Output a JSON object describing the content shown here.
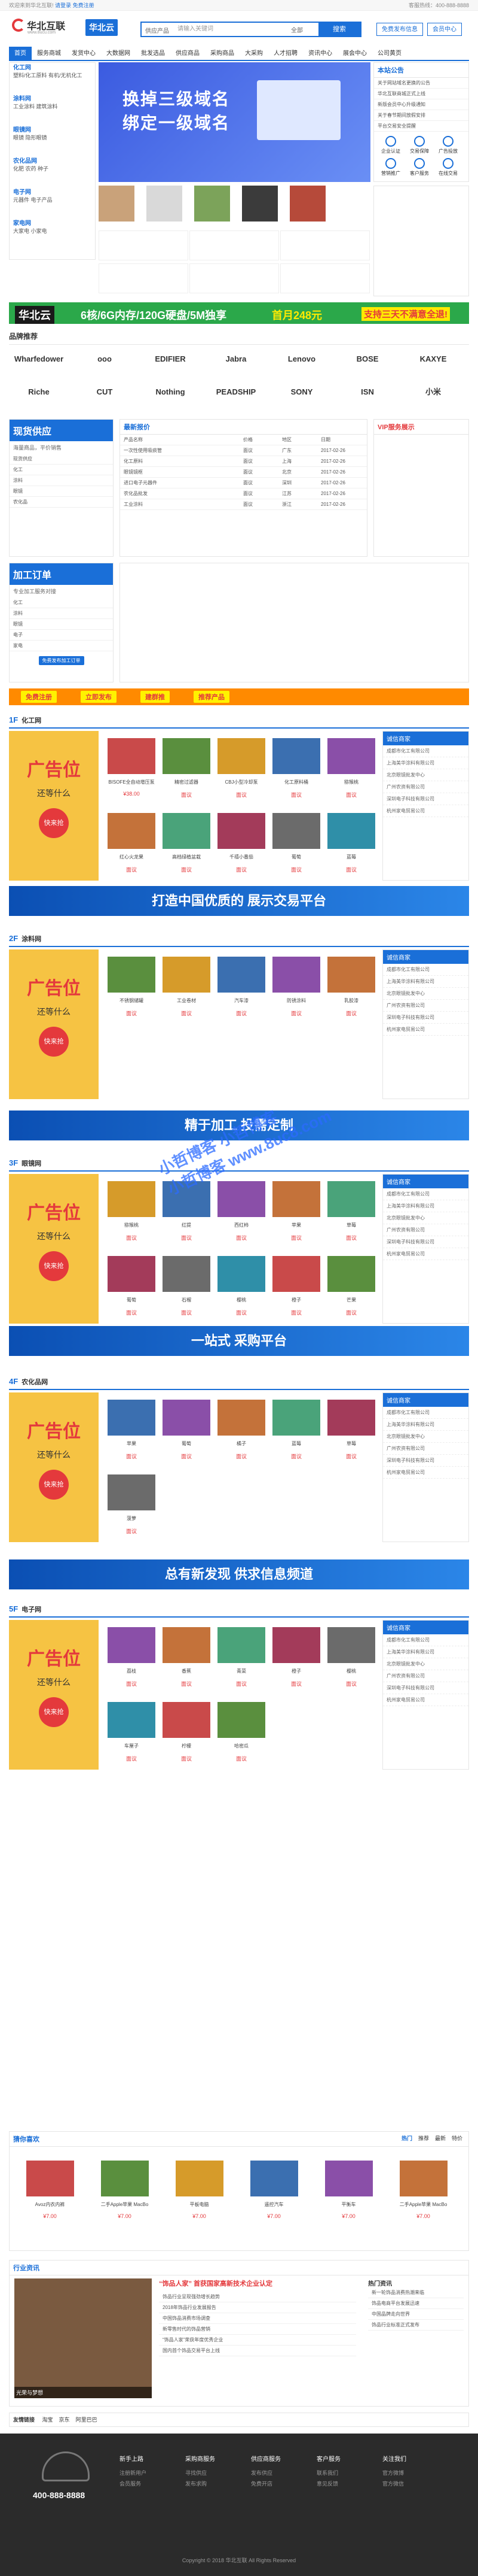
{
  "top": {
    "left": "欢迎来到华北互联!",
    "login": "请登录",
    "register": "免费注册",
    "right": "客服热线：400-888-8888"
  },
  "header": {
    "logo": "华北互联",
    "logo_sub": "www.8ucu.com",
    "logo2": "华北云",
    "search_kind": "供应产品",
    "search_placeholder": "请输入关键词",
    "search_select": "全部",
    "search_button": "搜索",
    "btn1": "免费发布信息",
    "btn2": "会员中心"
  },
  "nav": [
    "首页",
    "服务商城",
    "发货中心",
    "大数据网",
    "批发选品",
    "供应商品",
    "采购商品",
    "大采购",
    "人才招聘",
    "资讯中心",
    "展会中心",
    "公司黄页"
  ],
  "categories": [
    {
      "title": "化工网",
      "items": "塑料/化工原料 有机/无机化工"
    },
    {
      "title": "涂料网",
      "items": "工业涂料 建筑涂料"
    },
    {
      "title": "眼镜网",
      "items": "眼镜 隐形眼镜"
    },
    {
      "title": "农化品网",
      "items": "化肥 农药 种子"
    },
    {
      "title": "电子网",
      "items": "元器件 电子产品"
    },
    {
      "title": "家电网",
      "items": "大家电 小家电"
    }
  ],
  "banner": {
    "line1": "换掉三级域名",
    "line2": "绑定一级域名"
  },
  "news_right": {
    "title": "本站公告",
    "items": [
      "关于网站域名更换的公告",
      "华北互联商城正式上线",
      "新版会员中心升级通知",
      "关于春节期间放假安排",
      "平台交易安全提醒"
    ]
  },
  "service_icons": [
    "企业认证",
    "交易保障",
    "广告投放",
    "营销推广",
    "客户服务",
    "在线交易"
  ],
  "promo_bar": {
    "brand": "华北云",
    "text": "6核/6G内存/120G硬盘/5M独享",
    "price": "首月248元",
    "right": "支持三天不满意全退!"
  },
  "brands_title": "品牌推荐",
  "brands": [
    "Wharfedower",
    "ooo",
    "EDIFIER",
    "Jabra",
    "Lenovo",
    "BOSE",
    "KAXYE",
    "Riche",
    "CUT",
    "Nothing",
    "PEADSHIP",
    "SONY",
    "ISN",
    "小米"
  ],
  "supply": {
    "title": "现货供应",
    "subtitle": "海量商品，平价销售",
    "left_list": [
      "现货供应",
      "化工",
      "涂料",
      "眼镜",
      "农化品"
    ],
    "tab_title": "最新报价",
    "cols": [
      "产品名称",
      "价格",
      "地区",
      "日期"
    ],
    "rows": [
      [
        "一次性使用吸痰管",
        "面议",
        "广东",
        "2017-02-26"
      ],
      [
        "化工原料",
        "面议",
        "上海",
        "2017-02-26"
      ],
      [
        "眼镜镜框",
        "面议",
        "北京",
        "2017-02-26"
      ],
      [
        "进口电子元器件",
        "面议",
        "深圳",
        "2017-02-26"
      ],
      [
        "农化品批发",
        "面议",
        "江苏",
        "2017-02-26"
      ],
      [
        "工业涂料",
        "面议",
        "浙江",
        "2017-02-26"
      ]
    ],
    "vip_title": "VIP服务展示"
  },
  "process": {
    "title": "加工订单",
    "subtitle": "专业加工服务对接",
    "list": [
      "化工",
      "涂料",
      "眼镜",
      "电子",
      "家电"
    ],
    "btn": "免费发布加工订单"
  },
  "orange_bar": [
    "免费注册",
    "立即发布",
    "建群推",
    "推荐产品"
  ],
  "floors": [
    {
      "no": "1F",
      "name": "化工网",
      "products": [
        {
          "n": "BISOFE全自动增压泵",
          "p": "¥38.00"
        },
        {
          "n": "精密过滤器",
          "p": "面议"
        },
        {
          "n": "CBJ小型冷却泵",
          "p": "面议"
        },
        {
          "n": "化工原料桶",
          "p": "面议"
        },
        {
          "n": "猕猴桃",
          "p": "面议"
        },
        {
          "n": "红心火龙果",
          "p": "面议"
        },
        {
          "n": "高档绿植盆栽",
          "p": "面议"
        },
        {
          "n": "千禧小番茄",
          "p": "面议"
        },
        {
          "n": "葡萄",
          "p": "面议"
        },
        {
          "n": "蓝莓",
          "p": "面议"
        }
      ]
    },
    {
      "no": "2F",
      "name": "涂料网",
      "products": [
        {
          "n": "不锈钢储罐",
          "p": "面议"
        },
        {
          "n": "工业卷材",
          "p": "面议"
        },
        {
          "n": "汽车漆",
          "p": "面议"
        },
        {
          "n": "防锈涂料",
          "p": "面议"
        },
        {
          "n": "乳胶漆",
          "p": "面议"
        }
      ]
    },
    {
      "no": "3F",
      "name": "眼镜网",
      "products": [
        {
          "n": "猕猴桃",
          "p": "面议"
        },
        {
          "n": "红提",
          "p": "面议"
        },
        {
          "n": "西红柿",
          "p": "面议"
        },
        {
          "n": "苹果",
          "p": "面议"
        },
        {
          "n": "草莓",
          "p": "面议"
        },
        {
          "n": "葡萄",
          "p": "面议"
        },
        {
          "n": "石榴",
          "p": "面议"
        },
        {
          "n": "樱桃",
          "p": "面议"
        },
        {
          "n": "橙子",
          "p": "面议"
        },
        {
          "n": "芒果",
          "p": "面议"
        }
      ]
    },
    {
      "no": "4F",
      "name": "农化品网",
      "products": [
        {
          "n": "苹果",
          "p": "面议"
        },
        {
          "n": "葡萄",
          "p": "面议"
        },
        {
          "n": "橘子",
          "p": "面议"
        },
        {
          "n": "蓝莓",
          "p": "面议"
        },
        {
          "n": "草莓",
          "p": "面议"
        },
        {
          "n": "菠萝",
          "p": "面议"
        }
      ]
    },
    {
      "no": "5F",
      "name": "电子网",
      "products": [
        {
          "n": "荔枝",
          "p": "面议"
        },
        {
          "n": "香蕉",
          "p": "面议"
        },
        {
          "n": "青菜",
          "p": "面议"
        },
        {
          "n": "橙子",
          "p": "面议"
        },
        {
          "n": "樱桃",
          "p": "面议"
        },
        {
          "n": "车厘子",
          "p": "面议"
        },
        {
          "n": "柠檬",
          "p": "面议"
        },
        {
          "n": "哈密瓜",
          "p": "面议"
        }
      ]
    }
  ],
  "ad_text": {
    "a1": "广告位",
    "a2": "还等什么",
    "a3": "快来抢"
  },
  "floor_side_title": "诚信商家",
  "floor_side_items": [
    "成都市化工有限公司",
    "上海美华涂料有限公司",
    "北京眼镜批发中心",
    "广州农资有限公司",
    "深圳电子科技有限公司",
    "杭州家电贸易公司"
  ],
  "strips": [
    "打造中国优质的 展示交易平台",
    "精于加工 投需定制",
    "一站式 采购平台",
    "总有新发现 供求信息频道"
  ],
  "hot": {
    "title": "猜你喜欢",
    "tabs": [
      "热门",
      "推荐",
      "最新",
      "特价"
    ],
    "items": [
      {
        "n": "Avoz内衣内裤",
        "p": "¥7.00"
      },
      {
        "n": "二手Apple苹果 MacBo",
        "p": "¥7.00"
      },
      {
        "n": "平板电脑",
        "p": "¥7.00"
      },
      {
        "n": "遥控汽车",
        "p": "¥7.00"
      },
      {
        "n": "平衡车",
        "p": "¥7.00"
      },
      {
        "n": "二手Apple苹果 MacBo",
        "p": "¥7.00"
      }
    ]
  },
  "news": {
    "title": "行业资讯",
    "caption": "光荣与梦想",
    "headline": "“饰品人家” 首获国家高新技术企业认定",
    "items": [
      "饰品行业呈现强劲增长趋势",
      "2018年饰品行业发展报告",
      "中国饰品消费市场调查",
      "新零售时代的饰品营销",
      "“饰品人家”荣获年度优秀企业",
      "国内首个饰品交易平台上线"
    ],
    "side_title": "热门资讯",
    "side_items": [
      "新一轮饰品消费热潮来临",
      "饰品电商平台发展迅速",
      "中国品牌走向世界",
      "饰品行业标准正式发布"
    ]
  },
  "links": {
    "title": "友情链接",
    "items": [
      "淘宝",
      "京东",
      "阿里巴巴"
    ]
  },
  "footer": {
    "hotline": "400-888-8888",
    "cols": [
      {
        "t": "新手上路",
        "i": [
          "注册新用户",
          "会员服务"
        ]
      },
      {
        "t": "采购商服务",
        "i": [
          "寻找供应",
          "发布求购"
        ]
      },
      {
        "t": "供应商服务",
        "i": [
          "发布供应",
          "免费开店"
        ]
      },
      {
        "t": "客户服务",
        "i": [
          "联系我们",
          "意见反馈"
        ]
      },
      {
        "t": "关注我们",
        "i": [
          "官方微博",
          "官方微信"
        ]
      }
    ],
    "copy": "Copyright © 2018 华北互联 All Rights Reserved"
  },
  "watermark": [
    "小哲博客 小哲博客",
    "小哲博客 www.8uc8.com"
  ]
}
